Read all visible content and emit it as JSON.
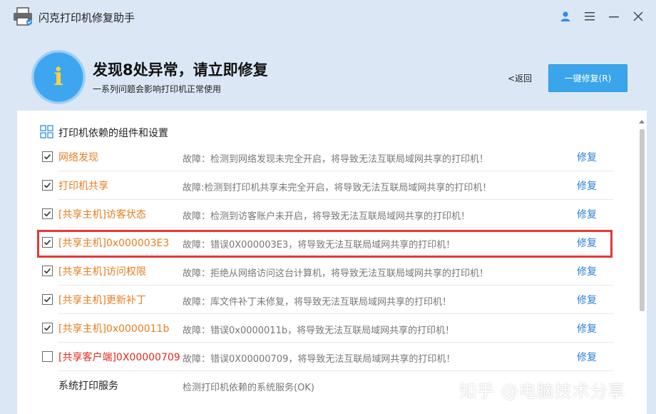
{
  "window": {
    "title": "闪克打印机修复助手",
    "icons": [
      "printer-icon",
      "user-icon",
      "menu-icon",
      "minimize-icon",
      "close-icon"
    ]
  },
  "header": {
    "headline": "发现8处异常，请立即修复",
    "subline": "一系列问题会影响打印机正常使用",
    "back_label": "<返回",
    "fix_all_label": "一键修复(R)",
    "info_glyph": "i"
  },
  "section": {
    "title": "打印机依赖的组件和设置"
  },
  "rows": [
    {
      "name": "网络发现",
      "desc": "故障：检测到网络发现未完全开启，将导致无法互联局域网共享的打印机！",
      "fix": "修复",
      "checked": true,
      "color": "orange"
    },
    {
      "name": "打印机共享",
      "desc": "故障:检测到打印机共享未完全开启，将导致无法互联局域网共享的打印机！",
      "fix": "修复",
      "checked": true,
      "color": "orange"
    },
    {
      "name": "[共享主机]访客状态",
      "desc": "故障：检测到访客账户未开启，将导致无法互联局域网共享的打印机！",
      "fix": "修复",
      "checked": true,
      "color": "orange"
    },
    {
      "name": "[共享主机]0x000003E3",
      "desc": "故障：错误0X000003E3，将导致无法互联局域网共享的打印机！",
      "fix": "修复",
      "checked": true,
      "color": "orange"
    },
    {
      "name": "[共享主机]访问权限",
      "desc": "故障：拒绝从网络访问这台计算机，将导致无法互联局域网共享的打印机！",
      "fix": "修复",
      "checked": true,
      "color": "orange"
    },
    {
      "name": "[共享主机]更新补丁",
      "desc": "故障：库文件补丁未修复，将导致无法互联局域网共享的打印机！",
      "fix": "修复",
      "checked": true,
      "color": "orange"
    },
    {
      "name": "[共享主机]0x0000011b",
      "desc": "故障：错误0x0000011b，将导致无法互联局域网共享的打印机！",
      "fix": "修复",
      "checked": true,
      "color": "orange"
    },
    {
      "name": "[共享客户端]0X00000709",
      "desc": "故障：错误0X00000709，将导致无法互联局域网共享的打印机！",
      "fix": "修复",
      "checked": false,
      "color": "red"
    },
    {
      "name": "系统打印服务",
      "desc": "检测打印机依赖的系统服务(OK)",
      "fix": "",
      "checked": null,
      "color": "plain"
    }
  ],
  "watermark": "知乎 @电脑技术分享",
  "colors": {
    "accent": "#3aa5ea",
    "warning_text": "#e67e22",
    "error_text": "#e0291f",
    "link": "#2b7fd6",
    "highlight_border": "#e53935",
    "background": "#dbe7f4"
  }
}
